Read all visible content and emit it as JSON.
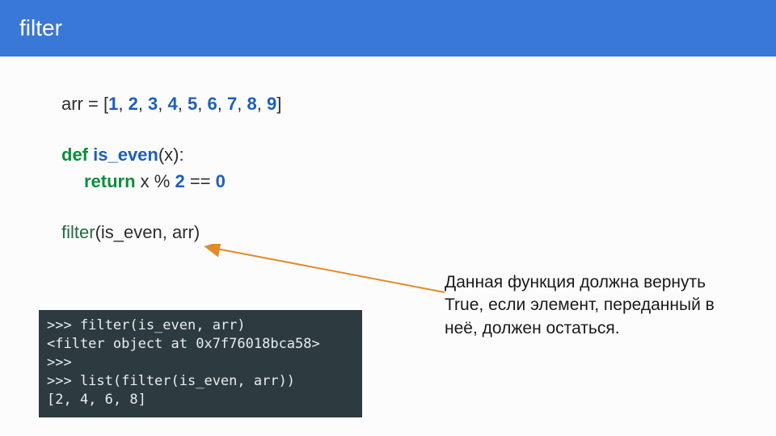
{
  "header": {
    "title": "filter"
  },
  "code": {
    "arr_decl_prefix": "arr = [",
    "arr_values": [
      "1",
      "2",
      "3",
      "4",
      "5",
      "6",
      "7",
      "8",
      "9"
    ],
    "arr_decl_suffix": "]",
    "def_kw": "def",
    "fn_name": "is_even",
    "fn_sig_suffix": "(x):",
    "return_kw": "return",
    "ret_expr_x": " x % ",
    "ret_two": "2",
    "ret_eq": " == ",
    "ret_zero": "0",
    "call_fn": "filter",
    "call_args": "(is_even, arr)"
  },
  "console": {
    "l1": ">>> filter(is_even, arr)",
    "l2": "<filter object at 0x7f76018bca58>",
    "l3": ">>>",
    "l4": ">>> list(filter(is_even, arr))",
    "l5": "[2, 4, 6, 8]"
  },
  "note": {
    "text": "Данная функция должна вернуть True, если элемент, переданный в неё, должен остаться."
  },
  "colors": {
    "header_bg": "#3a78d8",
    "arrow": "#e38b2a"
  }
}
